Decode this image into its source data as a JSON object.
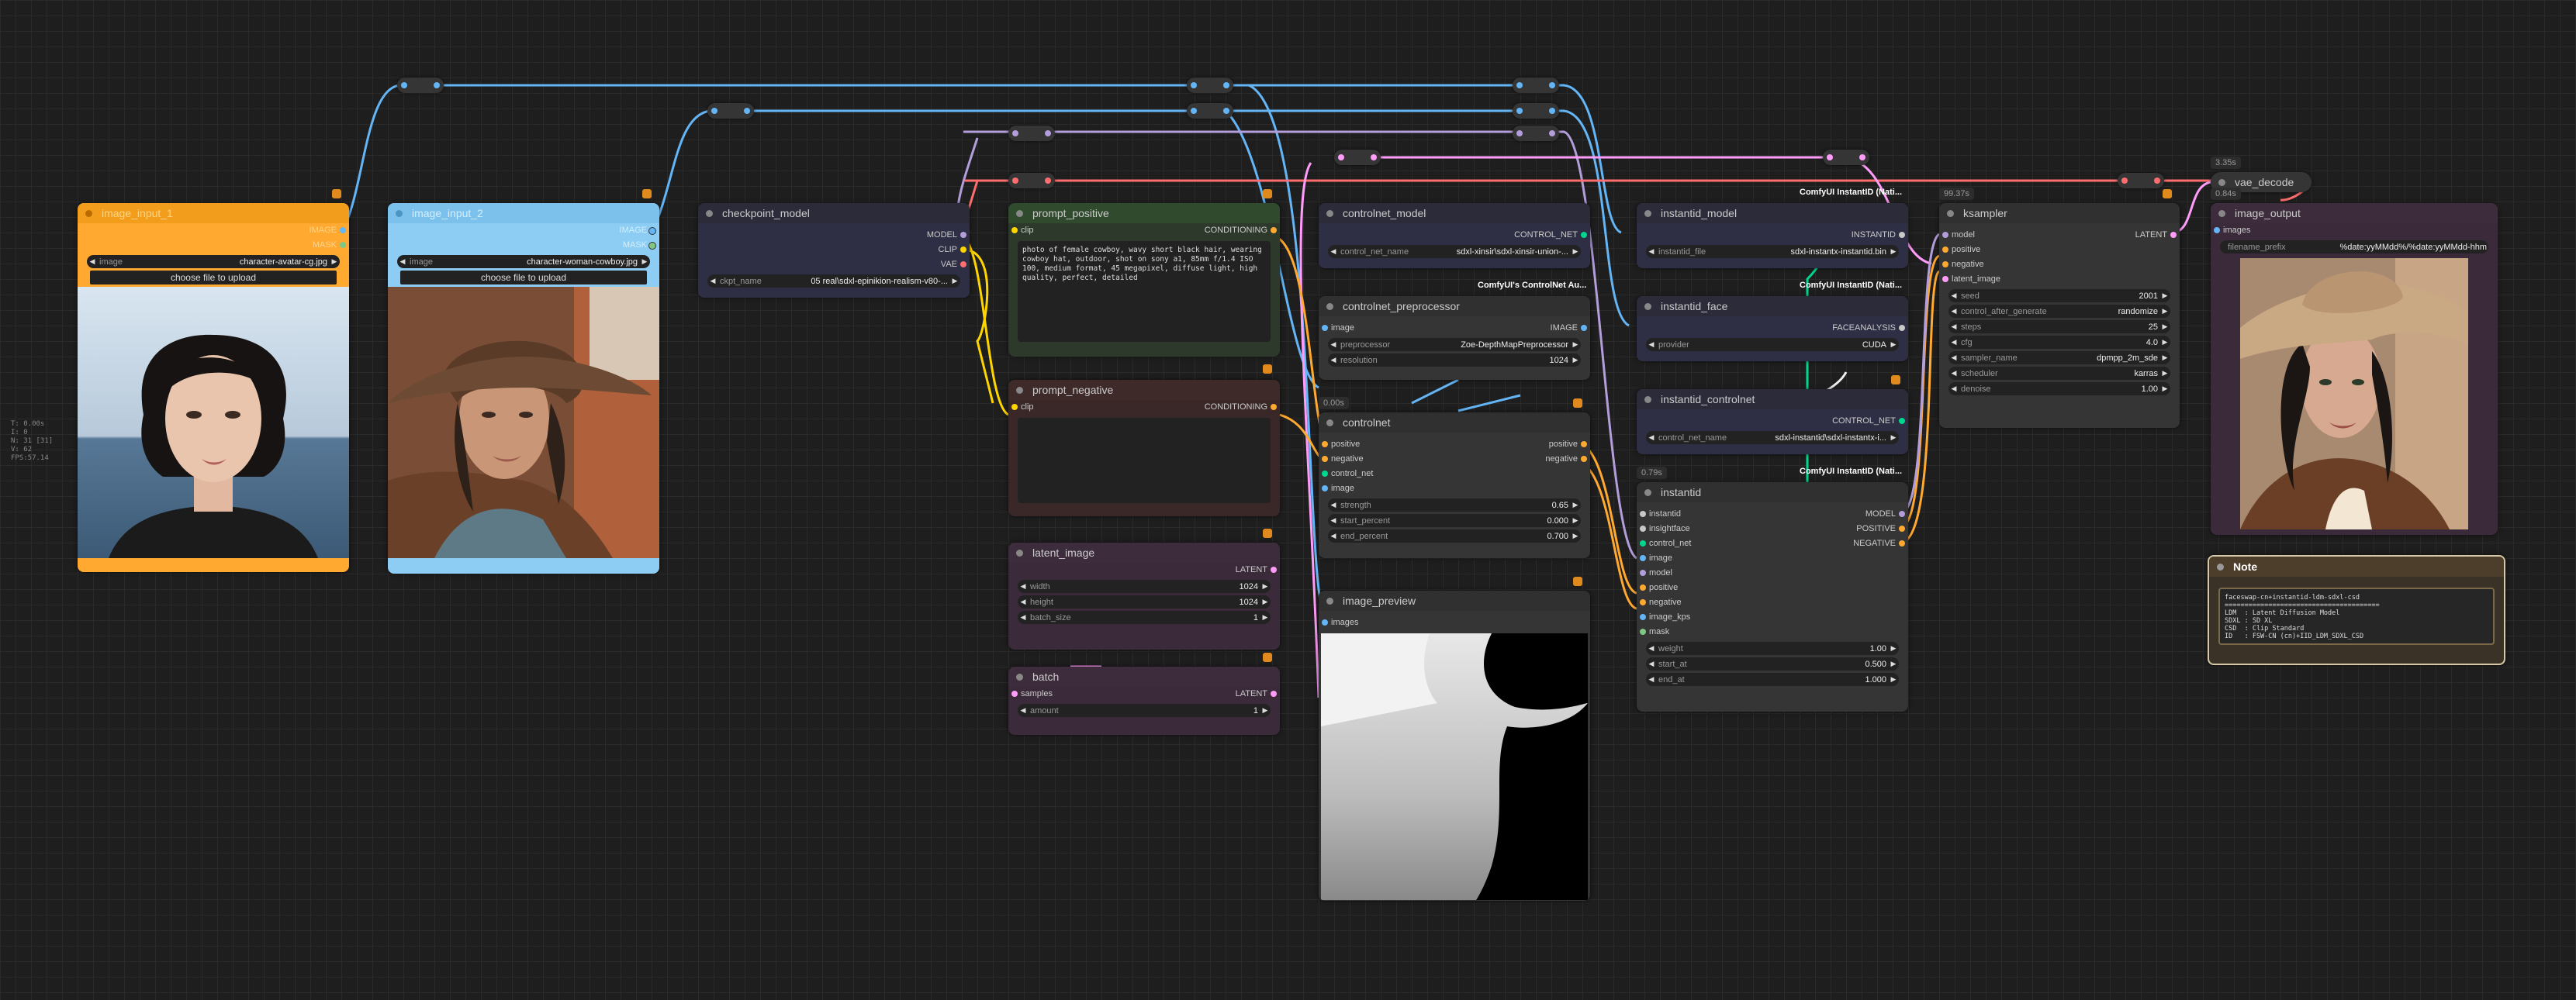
{
  "stats": {
    "lines": [
      "T: 0.00s",
      "I: 0",
      "N: 31 [31]",
      "V: 62",
      "FPS:57.14"
    ]
  },
  "image_input_1": {
    "title": "image_input_1",
    "out1": "IMAGE",
    "out2": "MASK",
    "w_image_label": "image",
    "w_image_value": "character-avatar-cg.jpg",
    "upload": "choose file to upload"
  },
  "image_input_2": {
    "title": "image_input_2",
    "out1": "IMAGE",
    "out2": "MASK",
    "w_image_label": "image",
    "w_image_value": "character-woman-cowboy.jpg",
    "upload": "choose file to upload"
  },
  "checkpoint": {
    "title": "checkpoint_model",
    "out1": "MODEL",
    "out2": "CLIP",
    "out3": "VAE",
    "w_label": "ckpt_name",
    "w_value": "05 real\\sdxl-epinikion-realism-v80-..."
  },
  "prompt_positive": {
    "title": "prompt_positive",
    "in1": "clip",
    "out1": "CONDITIONING",
    "text": "photo of female cowboy, wavy short black hair, wearing cowboy hat, outdoor, shot on sony a1, 85mm f/1.4 ISO 100, medium format, 45 megapixel, diffuse light, high quality, perfect, detailed"
  },
  "prompt_negative": {
    "title": "prompt_negative",
    "in1": "clip",
    "out1": "CONDITIONING",
    "text": ""
  },
  "latent_image": {
    "title": "latent_image",
    "out1": "LATENT",
    "width_label": "width",
    "width_value": "1024",
    "height_label": "height",
    "height_value": "1024",
    "batch_label": "batch_size",
    "batch_value": "1"
  },
  "batch": {
    "title": "batch",
    "in1": "samples",
    "out1": "LATENT",
    "amount_label": "amount",
    "amount_value": "1"
  },
  "controlnet_model": {
    "title": "controlnet_model",
    "out1": "CONTROL_NET",
    "w_label": "control_net_name",
    "w_value": "sdxl-xinsir\\sdxl-xinsir-union-...",
    "badge": "ComfyUI's ControlNet Au..."
  },
  "controlnet_preprocessor": {
    "title": "controlnet_preprocessor",
    "in1": "image",
    "out1": "IMAGE",
    "pre_label": "preprocessor",
    "pre_value": "Zoe-DepthMapPreprocessor",
    "res_label": "resolution",
    "res_value": "1024"
  },
  "controlnet": {
    "title": "controlnet",
    "time": "0.00s",
    "in1": "positive",
    "in2": "negative",
    "in3": "control_net",
    "in4": "image",
    "out1": "positive",
    "out2": "negative",
    "strength_label": "strength",
    "strength_value": "0.65",
    "start_label": "start_percent",
    "start_value": "0.000",
    "end_label": "end_percent",
    "end_value": "0.700"
  },
  "image_preview": {
    "title": "image_preview",
    "in1": "images"
  },
  "instantid_model": {
    "title": "instantid_model",
    "badge": "ComfyUI InstantID (Nati...",
    "out1": "INSTANTID",
    "w_label": "instantid_file",
    "w_value": "sdxl-instantx-instantid.bin"
  },
  "instantid_face": {
    "title": "instantid_face",
    "badge": "ComfyUI InstantID (Nati...",
    "out1": "FACEANALYSIS",
    "w_label": "provider",
    "w_value": "CUDA"
  },
  "instantid_controlnet": {
    "title": "instantid_controlnet",
    "badge": "ComfyUI InstantID (Nati...",
    "out1": "CONTROL_NET",
    "w_label": "control_net_name",
    "w_value": "sdxl-instantid\\sdxl-instantx-i..."
  },
  "instantid": {
    "title": "instantid",
    "time": "0.79s",
    "ins": [
      "instantid",
      "insightface",
      "control_net",
      "image",
      "model",
      "positive",
      "negative",
      "image_kps",
      "mask"
    ],
    "out1": "MODEL",
    "out2": "POSITIVE",
    "out3": "NEGATIVE",
    "weight_label": "weight",
    "weight_value": "1.00",
    "start_label": "start_at",
    "start_value": "0.500",
    "end_label": "end_at",
    "end_value": "1.000"
  },
  "ksampler": {
    "title": "ksampler",
    "time": "99.37s",
    "ins": [
      "model",
      "positive",
      "negative",
      "latent_image"
    ],
    "out1": "LATENT",
    "widgets": [
      [
        "seed",
        "2001"
      ],
      [
        "control_after_generate",
        "randomize"
      ],
      [
        "steps",
        "25"
      ],
      [
        "cfg",
        "4.0"
      ],
      [
        "sampler_name",
        "dpmpp_2m_sde"
      ],
      [
        "scheduler",
        "karras"
      ],
      [
        "denoise",
        "1.00"
      ]
    ]
  },
  "vae_decode": {
    "title": "vae_decode",
    "time": "3.35s"
  },
  "image_output": {
    "title": "image_output",
    "time": "0.84s",
    "in1": "images",
    "w_label": "filename_prefix",
    "w_value": "%date:yyMMdd%/%date:yyMMdd-hhm"
  },
  "note": {
    "title": "Note",
    "text": "faceswap-cn+instantid-ldm-sdxl-csd\n=======================================\nLDM  : Latent Diffusion Model\nSDXL : SD XL\nCSD  : Clip Standard\nID   : FSW-CN (cn)+IID_LDM_SDXL_CSD"
  },
  "colors": {
    "model": "#b39ddb",
    "clip": "#ffd500",
    "vae": "#ff6e6e",
    "conditioning": "#ffa931",
    "latent": "#ff9cf9",
    "image": "#64b5f6",
    "control_net": "#00d78d"
  }
}
